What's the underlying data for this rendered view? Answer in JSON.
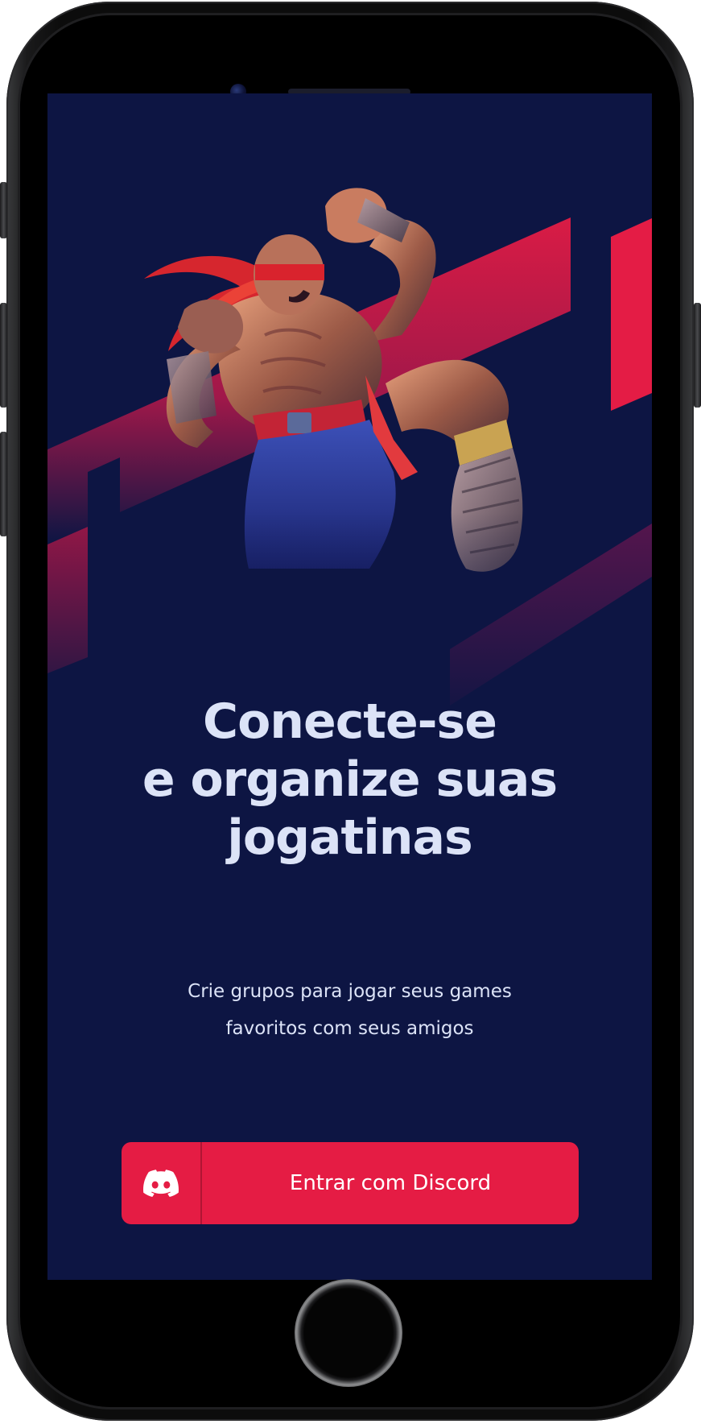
{
  "screen": {
    "title_lines": [
      "Conecte-se",
      "e organize suas",
      "jogatinas"
    ],
    "subtitle_lines": [
      "Crie grupos para jogar seus games",
      "favoritos com seus amigos"
    ],
    "login_button": {
      "label": "Entrar com Discord",
      "icon": "discord-icon"
    }
  },
  "colors": {
    "background": "#0d1543",
    "accent": "#e51c44",
    "text": "#dce3f7"
  }
}
